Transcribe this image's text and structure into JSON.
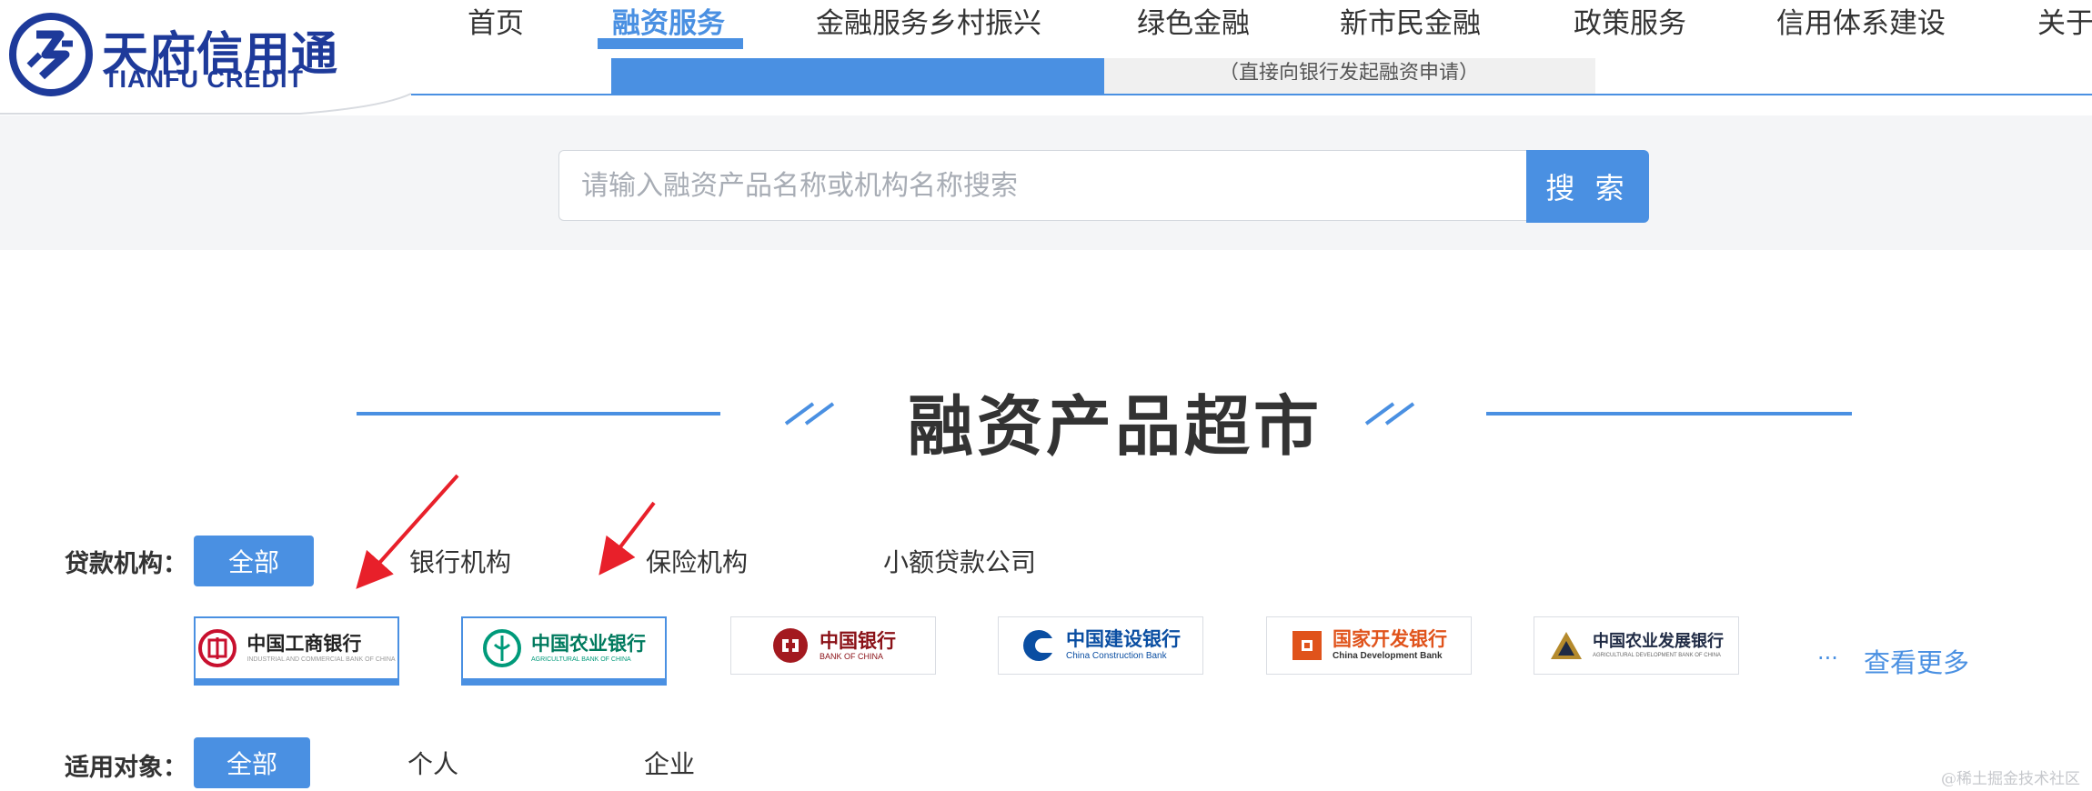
{
  "logo": {
    "cn": "天府信用通",
    "en": "TIANFU CREDIT"
  },
  "nav": {
    "items": [
      {
        "label": "首页"
      },
      {
        "label": "融资服务",
        "active": true
      },
      {
        "label": "金融服务乡村振兴"
      },
      {
        "label": "绿色金融"
      },
      {
        "label": "新市民金融"
      },
      {
        "label": "政策服务"
      },
      {
        "label": "信用体系建设"
      },
      {
        "label": "关于"
      }
    ]
  },
  "sub_tab": {
    "text": "（直接向银行发起融资申请）"
  },
  "search": {
    "placeholder": "请输入融资产品名称或机构名称搜索",
    "button_label": "搜 索"
  },
  "section": {
    "title": "融资产品超市"
  },
  "filters": {
    "institution": {
      "label": "贷款机构：",
      "options": [
        {
          "label": "全部",
          "active": true
        },
        {
          "label": "银行机构"
        },
        {
          "label": "保险机构"
        },
        {
          "label": "小额贷款公司"
        }
      ]
    },
    "audience": {
      "label": "适用对象：",
      "options": [
        {
          "label": "全部",
          "active": true
        },
        {
          "label": "个人"
        },
        {
          "label": "企业"
        }
      ]
    }
  },
  "banks": [
    {
      "cn": "中国工商银行",
      "en": "INDUSTRIAL AND COMMERCIAL BANK OF CHINA",
      "color": "#c8102e",
      "icon": "icbc-logo-icon"
    },
    {
      "cn": "中国农业银行",
      "en": "AGRICULTURAL BANK OF CHINA",
      "color": "#009a7a",
      "icon": "abc-logo-icon"
    },
    {
      "cn": "中国银行",
      "en": "BANK OF CHINA",
      "color": "#a3191f",
      "icon": "boc-logo-icon"
    },
    {
      "cn": "中国建设银行",
      "en": "China Construction Bank",
      "color": "#0a4ea2",
      "icon": "ccb-logo-icon"
    },
    {
      "cn": "国家开发银行",
      "en": "China Development Bank",
      "color": "#e0531b",
      "icon": "cdb-logo-icon"
    },
    {
      "cn": "中国农业发展银行",
      "en": "AGRICULTURAL DEVELOPMENT BANK OF CHINA",
      "color": "#1f2a44",
      "icon": "adbc-logo-icon"
    }
  ],
  "more": {
    "dots": "···",
    "label": "查看更多"
  },
  "watermark": "@稀土掘金技术社区",
  "colors": {
    "accent": "#4a90e2",
    "brand": "#1e3a9a",
    "annotation": "#e8202a"
  }
}
